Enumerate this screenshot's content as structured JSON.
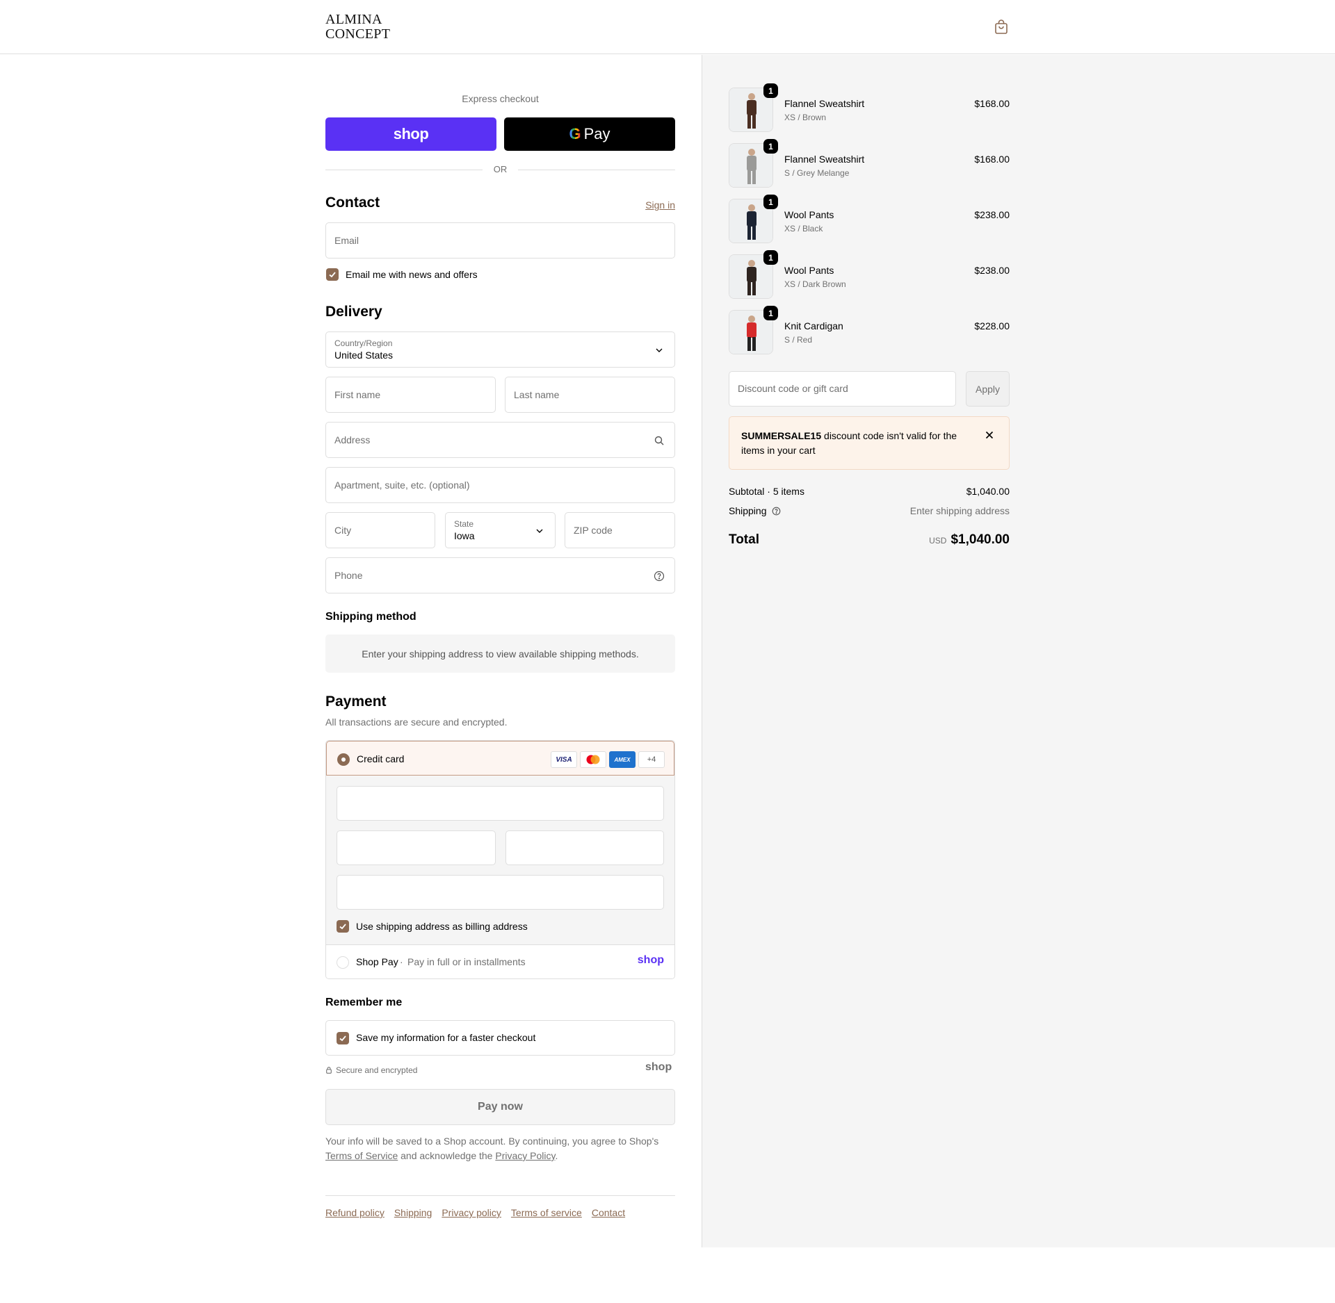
{
  "header": {
    "logo_line1": "ALMINA",
    "logo_line2": "CONCEPT",
    "cart_icon": "shopping-bag-icon"
  },
  "express": {
    "title": "Express checkout",
    "shop_pay_label": "shop",
    "gpay_g": "G",
    "gpay_label": "Pay",
    "or_label": "OR"
  },
  "contact": {
    "heading": "Contact",
    "sign_in": "Sign in",
    "email_placeholder": "Email",
    "news_label": "Email me with news and offers",
    "news_checked": true
  },
  "delivery": {
    "heading": "Delivery",
    "country_label": "Country/Region",
    "country_value": "United States",
    "first_name_placeholder": "First name",
    "last_name_placeholder": "Last name",
    "address_placeholder": "Address",
    "apartment_placeholder": "Apartment, suite, etc. (optional)",
    "city_placeholder": "City",
    "state_label": "State",
    "state_value": "Iowa",
    "zip_placeholder": "ZIP code",
    "phone_placeholder": "Phone"
  },
  "shipping_method": {
    "heading": "Shipping method",
    "note": "Enter your shipping address to view available shipping methods."
  },
  "payment": {
    "heading": "Payment",
    "subtitle": "All transactions are secure and encrypted.",
    "credit_card_label": "Credit card",
    "card_logos": [
      "VISA",
      "",
      "AMEX"
    ],
    "more_cards": "+4",
    "billing_label": "Use shipping address as billing address",
    "billing_checked": true,
    "shop_pay_label": "Shop Pay",
    "shop_pay_sep": "·",
    "shop_pay_desc": "Pay in full or in installments",
    "shop_pay_logo": "shop"
  },
  "remember": {
    "heading": "Remember me",
    "save_label": "Save my information for a faster checkout",
    "save_checked": true,
    "secure_label": "Secure and encrypted",
    "shop_logo": "shop"
  },
  "pay_now": "Pay now",
  "legal": {
    "text1": "Your info will be saved to a Shop account. By continuing, you agree to Shop's",
    "terms_link": "Terms of Service",
    "text2": "and acknowledge the",
    "privacy_link": "Privacy Policy",
    "text3": "."
  },
  "footer": {
    "links": [
      "Refund policy",
      "Shipping",
      "Privacy policy",
      "Terms of service",
      "Contact"
    ]
  },
  "cart": {
    "items": [
      {
        "name": "Flannel Sweatshirt",
        "variant": "XS / Brown",
        "price": "$168.00",
        "qty": "1",
        "color": "#4a2e22"
      },
      {
        "name": "Flannel Sweatshirt",
        "variant": "S / Grey Melange",
        "price": "$168.00",
        "qty": "1",
        "color": "#9a9a98"
      },
      {
        "name": "Wool Pants",
        "variant": "XS / Black",
        "price": "$238.00",
        "qty": "1",
        "color": "#1c2433"
      },
      {
        "name": "Wool Pants",
        "variant": "XS / Dark Brown",
        "price": "$238.00",
        "qty": "1",
        "color": "#2e2420"
      },
      {
        "name": "Knit Cardigan",
        "variant": "S / Red",
        "price": "$228.00",
        "qty": "1",
        "color": "#d52b2b"
      }
    ],
    "discount_placeholder": "Discount code or gift card",
    "apply_label": "Apply",
    "alert_code": "SUMMERSALE15",
    "alert_message": "discount code isn't valid for the items in your cart",
    "subtotal_label": "Subtotal · 5 items",
    "subtotal_value": "$1,040.00",
    "shipping_label": "Shipping",
    "shipping_value": "Enter shipping address",
    "total_label": "Total",
    "currency": "USD",
    "total_value": "$1,040.00"
  },
  "colors": {
    "accent": "#8b6a53",
    "shop_purple": "#5a31f4",
    "alert_bg": "#fdf3ea",
    "summary_bg": "#f5f5f5"
  }
}
